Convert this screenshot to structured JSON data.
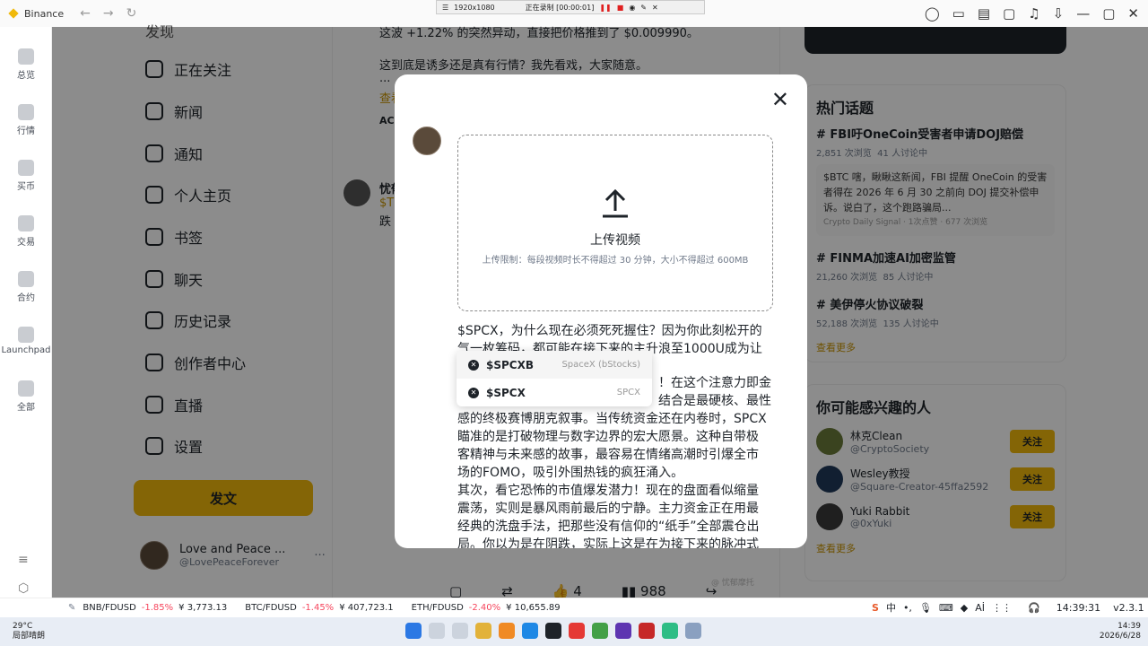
{
  "window": {
    "app_name": "Binance"
  },
  "recording": {
    "resolution": "1920x1080",
    "status": "正在录制 [00:00:01]"
  },
  "rail": [
    {
      "label": "总览",
      "icon": "overview-icon"
    },
    {
      "label": "行情",
      "icon": "market-icon"
    },
    {
      "label": "买币",
      "icon": "buy-icon"
    },
    {
      "label": "交易",
      "icon": "trade-icon"
    },
    {
      "label": "合约",
      "icon": "futures-icon"
    },
    {
      "label": "Launchpad",
      "icon": "rocket-icon"
    },
    {
      "label": "全部",
      "icon": "grid-icon"
    }
  ],
  "menu": [
    {
      "label": "正在关注"
    },
    {
      "label": "新闻"
    },
    {
      "label": "通知"
    },
    {
      "label": "个人主页"
    },
    {
      "label": "书签"
    },
    {
      "label": "聊天"
    },
    {
      "label": "历史记录"
    },
    {
      "label": "创作者中心"
    },
    {
      "label": "直播"
    },
    {
      "label": "设置"
    }
  ],
  "menu_top_partial": "发现",
  "post_button": "发文",
  "profile": {
    "name": "Love and Peace ...",
    "handle": "@LovePeaceForever"
  },
  "feed": {
    "line1": "这波 +1.22% 的突然异动，直接把价格推到了 $0.009990。",
    "line2": "这到底是诱多还是真有行情？我先看戏，大家随意。",
    "ellipsis": "...",
    "view_more": "查看",
    "tag": "AC",
    "second_author": "忧郁",
    "second_ticker": "$TR",
    "second_text": "跌",
    "likes": "4",
    "views": "988",
    "watermark": "@ 忧郁摩托"
  },
  "hot_topics": {
    "title": "热门话题",
    "items": [
      {
        "title": "FBI吁OneCoin受害者申请DOJ赔偿",
        "views": "2,851 次浏览",
        "discuss": "41 人讨论中",
        "preview": "$BTC 嗐，瞅瞅这新闻，FBI 提醒 OneCoin 的受害者得在 2026 年 6 月 30 之前向 DOJ 提交补偿申诉。说白了，这个跑路骗局...",
        "source": "Crypto Daily Signal · 1次点赞 · 677 次浏览"
      },
      {
        "title": "FINMA加速AI加密监管",
        "views": "21,260 次浏览",
        "discuss": "85 人讨论中"
      },
      {
        "title": "美伊停火协议破裂",
        "views": "52,188 次浏览",
        "discuss": "135 人讨论中"
      }
    ],
    "more": "查看更多"
  },
  "people": {
    "title": "你可能感兴趣的人",
    "items": [
      {
        "name": "林克Clean",
        "handle": "@CryptoSociety",
        "follow": "关注"
      },
      {
        "name": "Wesley教授",
        "handle": "@Square-Creator-45ffa2592",
        "follow": "关注"
      },
      {
        "name": "Yuki Rabbit",
        "handle": "@0xYuki",
        "follow": "关注"
      }
    ],
    "more": "查看更多"
  },
  "modal": {
    "upload_title": "上传视频",
    "upload_limit": "上传限制：每段视频时长不得超过 30 分钟，大小不得超过 600MB",
    "text_line1": "$SPCX，为什么现在必须死死握住？因为你此刻松开的",
    "text_line2": "气一枚筹码，都可能在接下来的主升浪至1000U成为让",
    "text_line3": "！在这个注意力即金",
    "text_line4": "结合是最硬核、最性",
    "text_line5": "感的终极赛博朋克叙事。当传统资金还在内卷时，SPCX",
    "text_line6": "瞄准的是打破物理与数字边界的宏大愿景。这种自带极",
    "text_line7": "客精神与未来感的故事，最容易在情绪高潮时引爆全市",
    "text_line8": "场的FOMO，吸引外围热钱的疯狂涌入。",
    "text_line9": "其次，看它恐怖的市值爆发潜力！现在的盘面看似缩量",
    "text_line10": "震荡，实则是暴风雨前最后的宁静。主力资金正在用最",
    "text_line11": "经典的洗盘手法，把那些没有信仰的“纸手”全部震仓出",
    "text_line12": "局。你以为是在阴跌，实际上这是在为接下来的脉冲式"
  },
  "suggestions": [
    {
      "ticker": "$SPCXB",
      "name": "SpaceX (bStocks)"
    },
    {
      "ticker": "$SPCX",
      "name": "SPCX"
    }
  ],
  "ticker_bar": [
    {
      "pair": "BNB/FDUSD",
      "change": "-1.85%",
      "price": "¥ 3,773.13"
    },
    {
      "pair": "BTC/FDUSD",
      "change": "-1.45%",
      "price": "¥ 407,723.1"
    },
    {
      "pair": "ETH/FDUSD",
      "change": "-2.40%",
      "price": "¥ 10,655.89"
    }
  ],
  "status": {
    "time": "14:39:31",
    "version": "v2.3.1",
    "ime": "中"
  },
  "taskbar": {
    "weather_temp": "29°C",
    "weather_desc": "局部晴朗",
    "clock_time": "14:39",
    "clock_date": "2026/6/28"
  },
  "colors": {
    "brand": "#f0b90b",
    "negative": "#f6465d"
  }
}
